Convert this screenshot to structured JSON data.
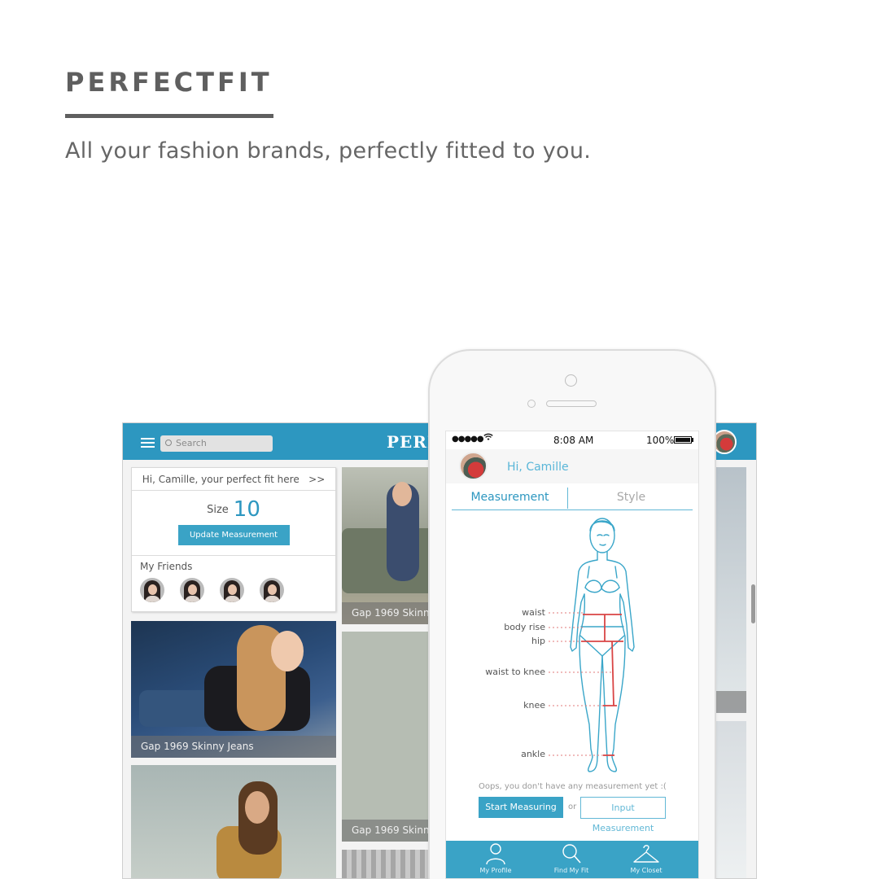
{
  "hero": {
    "title": "PERFECTFIT",
    "tagline": "All your fashion brands, perfectly fitted to you."
  },
  "tablet": {
    "search_placeholder": "Search",
    "logo_partial": "PERF",
    "greeting": "Hi, Camille, your perfect fit here",
    "greeting_arrow": ">>",
    "size_label": "Size",
    "size_value": "10",
    "update_button": "Update Measurement",
    "friends_label": "My Friends",
    "photos": [
      {
        "caption": "Gap 1969 Skinny Jeans"
      },
      {
        "caption": "Gap 1969 Skinny"
      },
      {
        "caption": "Gap 1969 Skinny"
      }
    ]
  },
  "phone": {
    "status": {
      "carrier": "●●●●●",
      "time": "8:08 AM",
      "battery": "100%"
    },
    "greeting": "Hi, Camille",
    "tabs": [
      "Measurement",
      "Style"
    ],
    "measurements": [
      "waist",
      "body rise",
      "hip",
      "waist to knee",
      "knee",
      "ankle"
    ],
    "empty_message": "Oops, you don't have any measurement yet :(",
    "start_button": "Start Measuring",
    "or_text": "or",
    "input_button": "Input Measurement",
    "tabbar": [
      "My Profile",
      "Find My Fit",
      "My Closet"
    ]
  },
  "colors": {
    "accent": "#2d97c0",
    "measure_line": "#d94444",
    "heading": "#5f5f5f"
  }
}
